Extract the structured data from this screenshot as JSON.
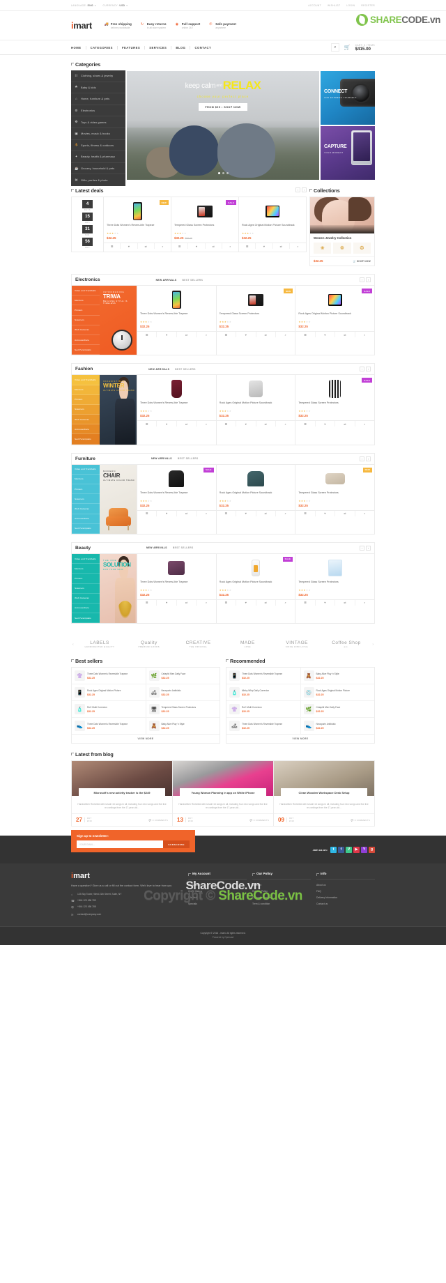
{
  "topbar": {
    "left": [
      {
        "label": "LANGUAGE:",
        "value": "ENG"
      },
      {
        "label": "CURRENCY:",
        "value": "USD"
      }
    ],
    "right": [
      "ACCOUNT",
      "WISHLIST",
      "LOGIN",
      "REGISTER"
    ]
  },
  "header": {
    "logo_i": "i",
    "logo_mart": "mart",
    "features": [
      {
        "icon": "truck-icon",
        "title": "Free shipping",
        "sub": "delivery worldwide"
      },
      {
        "icon": "refresh-icon",
        "title": "Easy returns",
        "sub": "in all store system"
      },
      {
        "icon": "lifebuoy-icon",
        "title": "Full support",
        "sub": "online 24/7"
      },
      {
        "icon": "phone-icon",
        "title": "Safe payment",
        "sub": "anywhere"
      }
    ],
    "watermark": {
      "share": "SHARE",
      "code": "CODE.vn"
    }
  },
  "nav": {
    "menu": [
      "HOME",
      "CATEGORIES",
      "FEATURES",
      "SERVICES",
      "BLOG",
      "CONTACT"
    ],
    "search_icon": "search-icon",
    "cart_icon": "cart-icon",
    "cart_label": "CART: 3 ITEMS",
    "cart_total": "$415.00"
  },
  "categories": {
    "title": "Categories",
    "items": [
      {
        "icon": "☷",
        "label": "Clothing, shoes & jewelry"
      },
      {
        "icon": "☘",
        "label": "Baby & kids"
      },
      {
        "icon": "⌂",
        "label": "Home, furniture & pets"
      },
      {
        "icon": "⚙",
        "label": "Electronics"
      },
      {
        "icon": "❁",
        "label": "Toys & video games"
      },
      {
        "icon": "▣",
        "label": "Movies, music & books"
      },
      {
        "icon": "⛹",
        "label": "Sports, fitness & outdoors"
      },
      {
        "icon": "✦",
        "label": "Beauty, health & pharmacy"
      },
      {
        "icon": "☕",
        "label": "Grocery, household & pets"
      },
      {
        "icon": "⌘",
        "label": "Gifts, parties & photo"
      }
    ]
  },
  "hero": {
    "line1": "keep calm",
    "and": "and",
    "line2": "RELAX",
    "sub": "choose your perfect place",
    "button": "FROM $99 • SHOP NOW",
    "side": [
      {
        "title": "CONNECT",
        "sub": "AND EXPRESS YOURSELF"
      },
      {
        "title": "CAPTURE",
        "sub": "YOUR MOMENT"
      }
    ]
  },
  "latest_deals": {
    "title": "Latest deals",
    "countdown": [
      {
        "num": "4",
        "label": "DAYS"
      },
      {
        "num": "15",
        "label": "HRS"
      },
      {
        "num": "31",
        "label": "MIN"
      },
      {
        "num": "56",
        "label": "SEC"
      }
    ],
    "products": [
      {
        "name": "Three Dots Women's Revers-ible Trapeze",
        "price": "$32.25",
        "old": "",
        "badge": "NEW",
        "badge_type": "b-new",
        "stars": 3,
        "img": "phone"
      },
      {
        "name": "Tempered Glass Screen Protectors",
        "price": "$32.25",
        "old": "$50.00",
        "badge": "SALE",
        "badge_type": "b-sale",
        "stars": 3,
        "img": "tablet"
      },
      {
        "name": "Rock Ages Original Motion Picture Soundtrack",
        "price": "$32.25",
        "old": "",
        "badge": "",
        "badge_type": "",
        "stars": 3,
        "img": "note"
      }
    ],
    "actions": [
      "☰",
      "♥",
      "⇄",
      "⌕"
    ]
  },
  "collections": {
    "title": "Collections",
    "name": "Women Jewelry Collection",
    "price": "$32.25",
    "shop": "SHOP NOW",
    "items": [
      "❀",
      "❁",
      "❂"
    ]
  },
  "blocks": [
    {
      "title": "Electronics",
      "tabs": [
        "NEW ARRIVALS",
        "BEST SELLERS"
      ],
      "menu_class": "m-elec",
      "banner_class": "bn-elec",
      "menu": [
        "Video and Trackballs",
        "Monitors",
        "Printers",
        "Scanners",
        "Web Cameras",
        "Accusserdiare",
        "Sed Perscipiatis"
      ],
      "banner": {
        "kicker": "INTRODUCING",
        "headline": "TRIWA",
        "sub": "BECAUSE STYLE IS TIMELESS",
        "art": "watch",
        "color": "#ffffff"
      },
      "products": [
        {
          "name": "Three Dots Women's Revers-ible Trapeze",
          "price": "$32.25",
          "badge": "",
          "badge_type": "",
          "stars": 3,
          "img": "phone"
        },
        {
          "name": "Tempered Glass Screen Protectors",
          "price": "$32.25",
          "badge": "NEW",
          "badge_type": "b-new",
          "stars": 3,
          "img": "tablet"
        },
        {
          "name": "Rock Ages Original Motion Picture Soundtrack",
          "price": "$32.25",
          "badge": "SALE",
          "badge_type": "b-sale",
          "stars": 3,
          "img": "note"
        }
      ]
    },
    {
      "title": "Fashion",
      "tabs": [
        "NEW ARRIVALS",
        "BEST SELLERS"
      ],
      "menu_class": "m-fash",
      "banner_class": "bn-fash",
      "menu": [
        "Video and Trackballs",
        "Monitors",
        "Printers",
        "Scanners",
        "Web Cameras",
        "Accusserdiare",
        "Sed Perscipiatis"
      ],
      "banner": {
        "kicker": "IRRESISTIBLE",
        "headline": "WINTER",
        "sub": "ULTIMATE COLOR TREND",
        "art": "model",
        "color": "#f5c13f"
      },
      "products": [
        {
          "name": "Three Dots Women's Revers-ible Trapeze",
          "price": "$32.25",
          "badge": "",
          "badge_type": "",
          "stars": 3,
          "img": "dress"
        },
        {
          "name": "Rock Ages Original Motion Picture Soundtrack",
          "price": "$32.25",
          "badge": "",
          "badge_type": "",
          "stars": 3,
          "img": "shirt"
        },
        {
          "name": "Tempered Glass Screen Protectors",
          "price": "$32.25",
          "badge": "SALE",
          "badge_type": "b-sale",
          "stars": 3,
          "img": "strip"
        }
      ]
    },
    {
      "title": "Furniture",
      "tabs": [
        "NEW ARRIVALS",
        "BEST SELLERS"
      ],
      "menu_class": "m-furn",
      "banner_class": "bn-furn",
      "menu": [
        "Video and Trackballs",
        "Monitors",
        "Printers",
        "Scanners",
        "Web Cameras",
        "Accusserdiare",
        "Sed Perscipiatis"
      ],
      "banner": {
        "kicker": "MODERN",
        "headline": "CHAIR",
        "sub": "ULTIMATE COLOR TREND",
        "art": "chair",
        "color": "#3a3a3a"
      },
      "products": [
        {
          "name": "Three Dots Women's Revers-ible Trapeze",
          "price": "$32.25",
          "badge": "SALE",
          "badge_type": "b-sale",
          "stars": 3,
          "img": "chairB"
        },
        {
          "name": "Rock Ages Original Motion Picture Soundtrack",
          "price": "$32.25",
          "badge": "",
          "badge_type": "",
          "stars": 3,
          "img": "chairG"
        },
        {
          "name": "Tempered Glass Screen Protectors",
          "price": "$32.25",
          "badge": "NEW",
          "badge_type": "b-new",
          "stars": 3,
          "img": "sofa"
        }
      ]
    },
    {
      "title": "Beauty",
      "tabs": [
        "NEW ARRIVALS",
        "BEST SELLERS"
      ],
      "menu_class": "m-beau",
      "banner_class": "bn-beau",
      "menu": [
        "Video and Trackballs",
        "Monitors",
        "Printers",
        "Scanners",
        "Web Cameras",
        "Accusserdiare",
        "Sed Perscipiatis"
      ],
      "banner": {
        "kicker": "THE ONE",
        "headline": "SOLUTION",
        "sub": "FOR YOUR SKIN",
        "art": "neck",
        "color": "#18b8ac"
      },
      "products": [
        {
          "name": "Three Dots Women's Revers-ible Trapeze",
          "price": "$32.25",
          "badge": "",
          "badge_type": "",
          "stars": 3,
          "img": "jars"
        },
        {
          "name": "Rock Ages Original Motion Picture Soundtrack",
          "price": "$32.25",
          "badge": "SALE",
          "badge_type": "b-sale",
          "stars": 3,
          "img": "bottle"
        },
        {
          "name": "Tempered Glass Screen Protectors",
          "price": "$32.25",
          "badge": "",
          "badge_type": "",
          "stars": 3,
          "img": "box"
        }
      ]
    }
  ],
  "brands": [
    {
      "title": "LABELS",
      "sub": "HANDCRAFTED QUALITY"
    },
    {
      "title": "Quality",
      "sub": "PREMIUM GOODS"
    },
    {
      "title": "CREATIVE",
      "sub": "THE ORIGINAL"
    },
    {
      "title": "MADE",
      "sub": "LOVE"
    },
    {
      "title": "VINTAGE",
      "sub": "SINCE 1980 LOYAL"
    },
    {
      "title": "Coffee Shop",
      "sub": "est."
    }
  ],
  "best_sellers": {
    "title": "Best sellers",
    "view_more": "VIEW MORE",
    "col1": [
      {
        "name": "Three Dots Women's Reversible Trapeze",
        "price": "$32.25",
        "icon": "👚"
      },
      {
        "name": "Rock Ages Original Motion Picture",
        "price": "$32.25",
        "icon": "📱"
      },
      {
        "name": "RoC Multi Correxion",
        "price": "$32.25",
        "icon": "🧴"
      },
      {
        "name": "Three Dots Women's Reversible Trapeze",
        "price": "$32.25",
        "icon": "👟"
      }
    ],
    "col2": [
      {
        "name": "Cetaphil Men Daily Face",
        "price": "$32.25",
        "icon": "🌿"
      },
      {
        "name": "Neosporin Antibiotic",
        "price": "$32.25",
        "icon": "🛋"
      },
      {
        "name": "Tempered Glass Screen Protectors",
        "price": "$32.25",
        "icon": "🖥"
      },
      {
        "name": "Baby Alive Play 'n Style",
        "price": "$32.25",
        "icon": "🧸"
      }
    ]
  },
  "recommended": {
    "title": "Recommended",
    "view_more": "VIEW MORE",
    "col1": [
      {
        "name": "Three Dots Women's Reversible Trapeze",
        "price": "$32.25",
        "icon": "📱"
      },
      {
        "name": "Minky Whip Daily Correxion",
        "price": "$32.25",
        "icon": "🧴"
      },
      {
        "name": "RoC Multi Correxion",
        "price": "$32.25",
        "icon": "👚"
      },
      {
        "name": "Three Dots Women's Reversible Trapeze",
        "price": "$32.25",
        "icon": "🛋"
      }
    ],
    "col2": [
      {
        "name": "Baby Alive Play 'n Style",
        "price": "$32.25",
        "icon": "🧸"
      },
      {
        "name": "Rock Ages Original Motion Picture",
        "price": "$32.25",
        "icon": "💿"
      },
      {
        "name": "Cetaphil Men Daily Face",
        "price": "$32.25",
        "icon": "🌿"
      },
      {
        "name": "Neosporin Antibiotic",
        "price": "$32.25",
        "icon": "👟"
      }
    ]
  },
  "blog": {
    "title": "Latest from blog",
    "posts": [
      {
        "img_class": "bi1",
        "title": "Microsoft's new activity tracker is the $249",
        "excerpt": "Handwritten Revisited will include 16 songs in all, including four new songs and five live re-cordings from the 17-year-old...",
        "day": "27",
        "month": "OCT",
        "year": "2016",
        "comments": "0 COMMENTS"
      },
      {
        "img_class": "bi2",
        "title": "Young Woman Planning in app on White iPhone",
        "excerpt": "Handwritten Revisited will include 16 songs in all, including four new songs and five live re-cordings from the 17-year-old...",
        "day": "13",
        "month": "OCT",
        "year": "2016",
        "comments": "0 COMMENTS"
      },
      {
        "img_class": "bi3",
        "title": "Clean Wooden Workspace Desk Setup",
        "excerpt": "Handwritten Revisited will include 16 songs in all, including four new songs and five live re-cordings from the 17-year-old...",
        "day": "09",
        "month": "OCT",
        "year": "2016",
        "comments": "0 COMMENTS"
      }
    ]
  },
  "newsletter": {
    "heading": "Sign up to newsletter:",
    "placeholder": "YOUR EMAIL...",
    "button": "SUBSCRIBE",
    "join_label": "Join us on:",
    "socials": [
      {
        "name": "twitter-icon",
        "glyph": "t",
        "color": "#2fb8e6"
      },
      {
        "name": "facebook-icon",
        "glyph": "f",
        "color": "#3b5998"
      },
      {
        "name": "vine-icon",
        "glyph": "V",
        "color": "#3ec98c"
      },
      {
        "name": "youtube-icon",
        "glyph": "▶",
        "color": "#e0384a"
      },
      {
        "name": "yahoo-icon",
        "glyph": "Y",
        "color": "#8f3fd6"
      },
      {
        "name": "google-icon",
        "glyph": "g",
        "color": "#d64a3a"
      }
    ]
  },
  "footer": {
    "logo_i": "i",
    "logo_mart": "mart",
    "desc": "Have a question? Give us a call or fill out the contact form. We'd love to hear from you",
    "contacts": [
      {
        "icon": "pin-icon",
        "text": "123 Sky Tower, West 21th Street, Suite, NY"
      },
      {
        "icon": "phone-icon",
        "text": "+844 123 456 789"
      },
      {
        "icon": "fax-icon",
        "text": "+844 123 456 788"
      },
      {
        "icon": "mail-icon",
        "text": "contact@company.com"
      }
    ],
    "columns": [
      {
        "title": "My Account",
        "links": [
          "My Account",
          "Order History",
          "Wishlist",
          "Specials"
        ]
      },
      {
        "title": "Our Policy",
        "links": [
          "Discount",
          "Returns Policy",
          "Customer Service",
          "Term & condition"
        ]
      },
      {
        "title": "Info",
        "links": [
          "About us",
          "FAQ",
          "Delivery Information",
          "Contact us"
        ]
      }
    ],
    "watermark_top": "ShareCode.vn",
    "watermark_big_1": "Copyright © ",
    "watermark_big_c": "ShareCode.vn",
    "copyright": "Copyright © 2016 - imart. All rights reserved.",
    "powered": "Powered by Opencart"
  }
}
